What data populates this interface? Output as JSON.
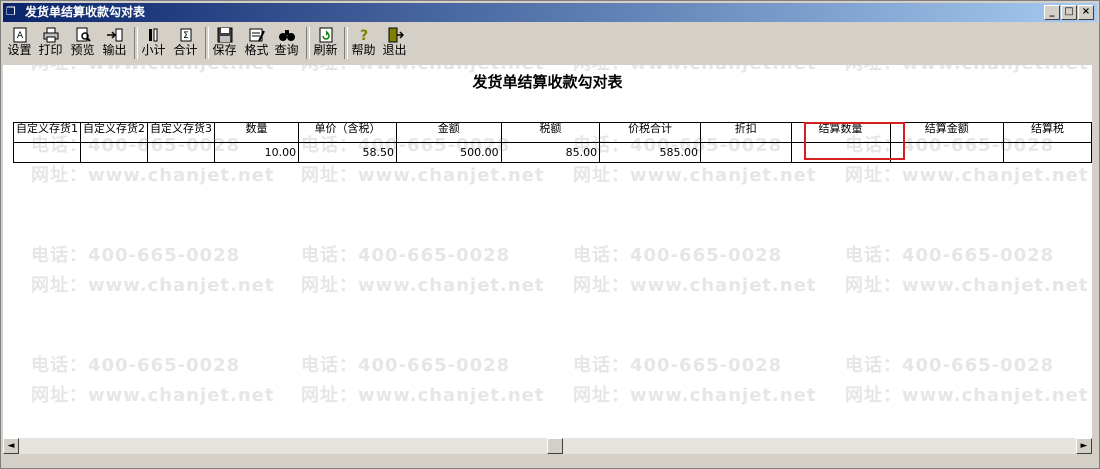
{
  "window": {
    "title": "发货单结算收款勾对表",
    "minimize": "_",
    "maximize": "□",
    "close": "×"
  },
  "toolbar": {
    "setup": "设置",
    "print": "打印",
    "preview": "预览",
    "export": "输出",
    "subtotal": "小计",
    "total": "合计",
    "save": "保存",
    "format": "格式",
    "query": "查询",
    "refresh": "刷新",
    "help": "帮助",
    "exit": "退出"
  },
  "report": {
    "title": "发货单结算收款勾对表",
    "columns": [
      "自定义存货1",
      "自定义存货2",
      "自定义存货3",
      "数量",
      "单价（含税）",
      "金额",
      "税额",
      "价税合计",
      "折扣",
      "结算数量",
      "结算金额",
      "结算税"
    ],
    "rows": [
      [
        "",
        "",
        "",
        "10.00",
        "58.50",
        "500.00",
        "85.00",
        "585.00",
        "",
        "",
        "",
        ""
      ]
    ]
  },
  "watermark": {
    "phone": "电话：400-665-0028",
    "site": "网址：www.chanjet.net"
  },
  "scrollbar": {
    "left": "◄",
    "right": "►"
  }
}
